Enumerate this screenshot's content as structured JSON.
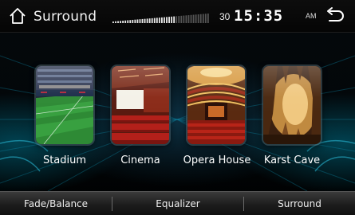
{
  "header": {
    "title": "Surround",
    "volume_value": "30",
    "volume_level": 0.65,
    "time": "15:35",
    "ampm": "AM"
  },
  "presets": [
    {
      "label": "Stadium",
      "icon": "stadium-icon"
    },
    {
      "label": "Cinema",
      "icon": "cinema-icon"
    },
    {
      "label": "Opera House",
      "icon": "opera-house-icon"
    },
    {
      "label": "Karst Cave",
      "icon": "cave-icon"
    }
  ],
  "tabs": [
    {
      "label": "Fade/Balance"
    },
    {
      "label": "Equalizer"
    },
    {
      "label": "Surround"
    }
  ],
  "colors": {
    "accent": "#16a6c8",
    "background": "#02070a",
    "tab_bar": "#2a2a2a"
  }
}
